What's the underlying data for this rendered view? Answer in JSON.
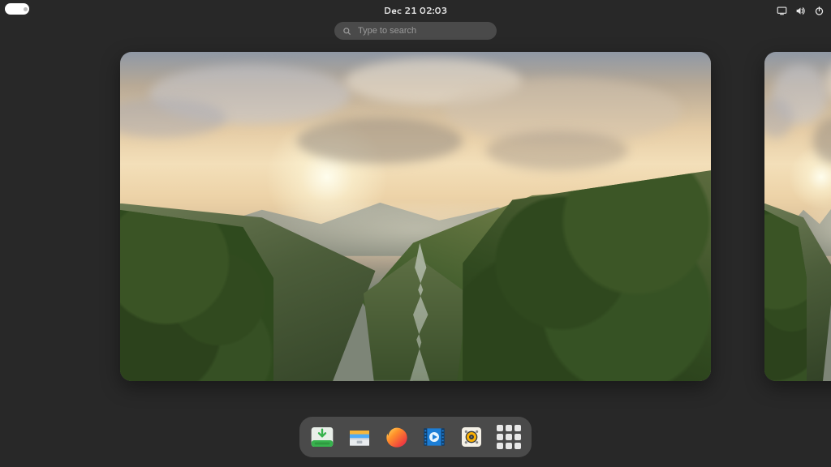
{
  "topbar": {
    "datetime": "Dec 21  02:03",
    "status_icons": [
      "screen-icon",
      "volume-icon",
      "power-icon"
    ]
  },
  "search": {
    "placeholder": "Type to search",
    "value": ""
  },
  "workspaces": {
    "current_index": 0,
    "count": 2
  },
  "dash": {
    "apps": [
      {
        "id": "installer",
        "name": "Ubiquity Installer"
      },
      {
        "id": "files",
        "name": "Files"
      },
      {
        "id": "firefox",
        "name": "Firefox"
      },
      {
        "id": "videos",
        "name": "Videos"
      },
      {
        "id": "rhythmbox",
        "name": "Rhythmbox"
      },
      {
        "id": "app-grid",
        "name": "Show Applications"
      }
    ]
  }
}
